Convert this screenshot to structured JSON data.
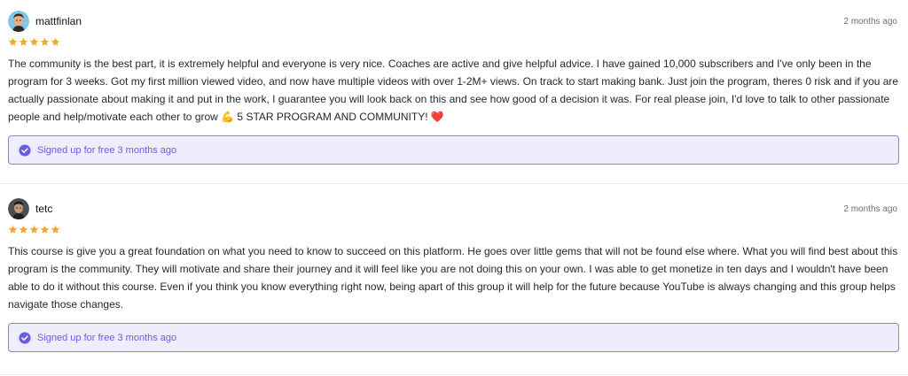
{
  "colors": {
    "star": "#f0a93a",
    "accent": "#6a5ce0",
    "signup_bg": "#eeedfb",
    "signup_border": "#8b7ff0"
  },
  "reviews": [
    {
      "username": "mattfinlan",
      "time": "2 months ago",
      "rating": 5,
      "text": "The community is the best part, it is extremely helpful and everyone is very nice. Coaches are active and give helpful advice. I have gained 10,000 subscribers and I've only been in the program for 3 weeks. Got my first million viewed video, and now have multiple videos with over 1-2M+ views. On track to start making bank. Just join the program, theres 0 risk and if you are actually passionate about making it and put in the work, I guarantee you will look back on this and see how good of a decision it was. For real please join, I'd love to talk to other passionate people and help/motivate each other to grow 💪 5 STAR PROGRAM AND COMMUNITY! ❤️",
      "signup": "Signed up for free 3 months ago",
      "icons": {
        "avatar": "user-avatar",
        "badge": "check-circle-icon",
        "rating": "star-icon"
      }
    },
    {
      "username": "tetc",
      "time": "2 months ago",
      "rating": 5,
      "text": "This course is give you a great foundation on what you need to know to succeed on this platform. He goes over little gems that will not be found else where. What you will find best about this program is the community. They will motivate and share their journey and it will feel like you are not doing this on your own. I was able to get monetize in ten days and I wouldn't have been able to do it without this course. Even if you think you know everything right now, being apart of this group it will help for the future because YouTube is always changing and this group helps navigate those changes.",
      "signup": "Signed up for free 3 months ago",
      "icons": {
        "avatar": "user-avatar",
        "badge": "check-circle-icon",
        "rating": "star-icon"
      }
    }
  ]
}
